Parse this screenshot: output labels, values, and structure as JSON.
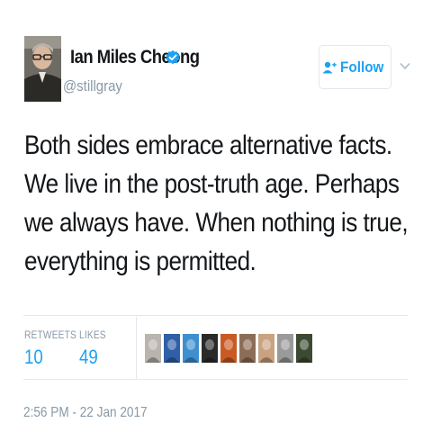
{
  "author": {
    "name": "Ian Miles Cheong",
    "handle": "@stillgray",
    "verified": true,
    "avatar_icon": "profile-photo"
  },
  "actions": {
    "follow_label": "Follow",
    "follow_icon": "add-user-icon",
    "more_icon": "chevron-down-icon"
  },
  "tweet": {
    "text": "Both sides embrace alternative facts. We live in the post-truth age. Perhaps we always have. When nothing is true, everything is permitted."
  },
  "stats": {
    "retweets_label": "RETWEETS",
    "retweets_count": "10",
    "likes_label": "LIKES",
    "likes_count": "49"
  },
  "likers": [
    {
      "name": "liker-1",
      "color": "#b9b4ad"
    },
    {
      "name": "liker-2",
      "color": "#2f5fa6"
    },
    {
      "name": "liker-3",
      "color": "#3e8fd0"
    },
    {
      "name": "liker-4",
      "color": "#2a2a2a"
    },
    {
      "name": "liker-5",
      "color": "#c95a24"
    },
    {
      "name": "liker-6",
      "color": "#8c6e58"
    },
    {
      "name": "liker-7",
      "color": "#c9a27f"
    },
    {
      "name": "liker-8",
      "color": "#9a9a9a"
    },
    {
      "name": "liker-9",
      "color": "#3d4a33"
    }
  ],
  "timestamp": "2:56 PM - 22 Jan 2017",
  "colors": {
    "accent": "#1da1f2",
    "muted": "#8899a6",
    "text": "#14171a",
    "border": "#e1e8ed"
  }
}
